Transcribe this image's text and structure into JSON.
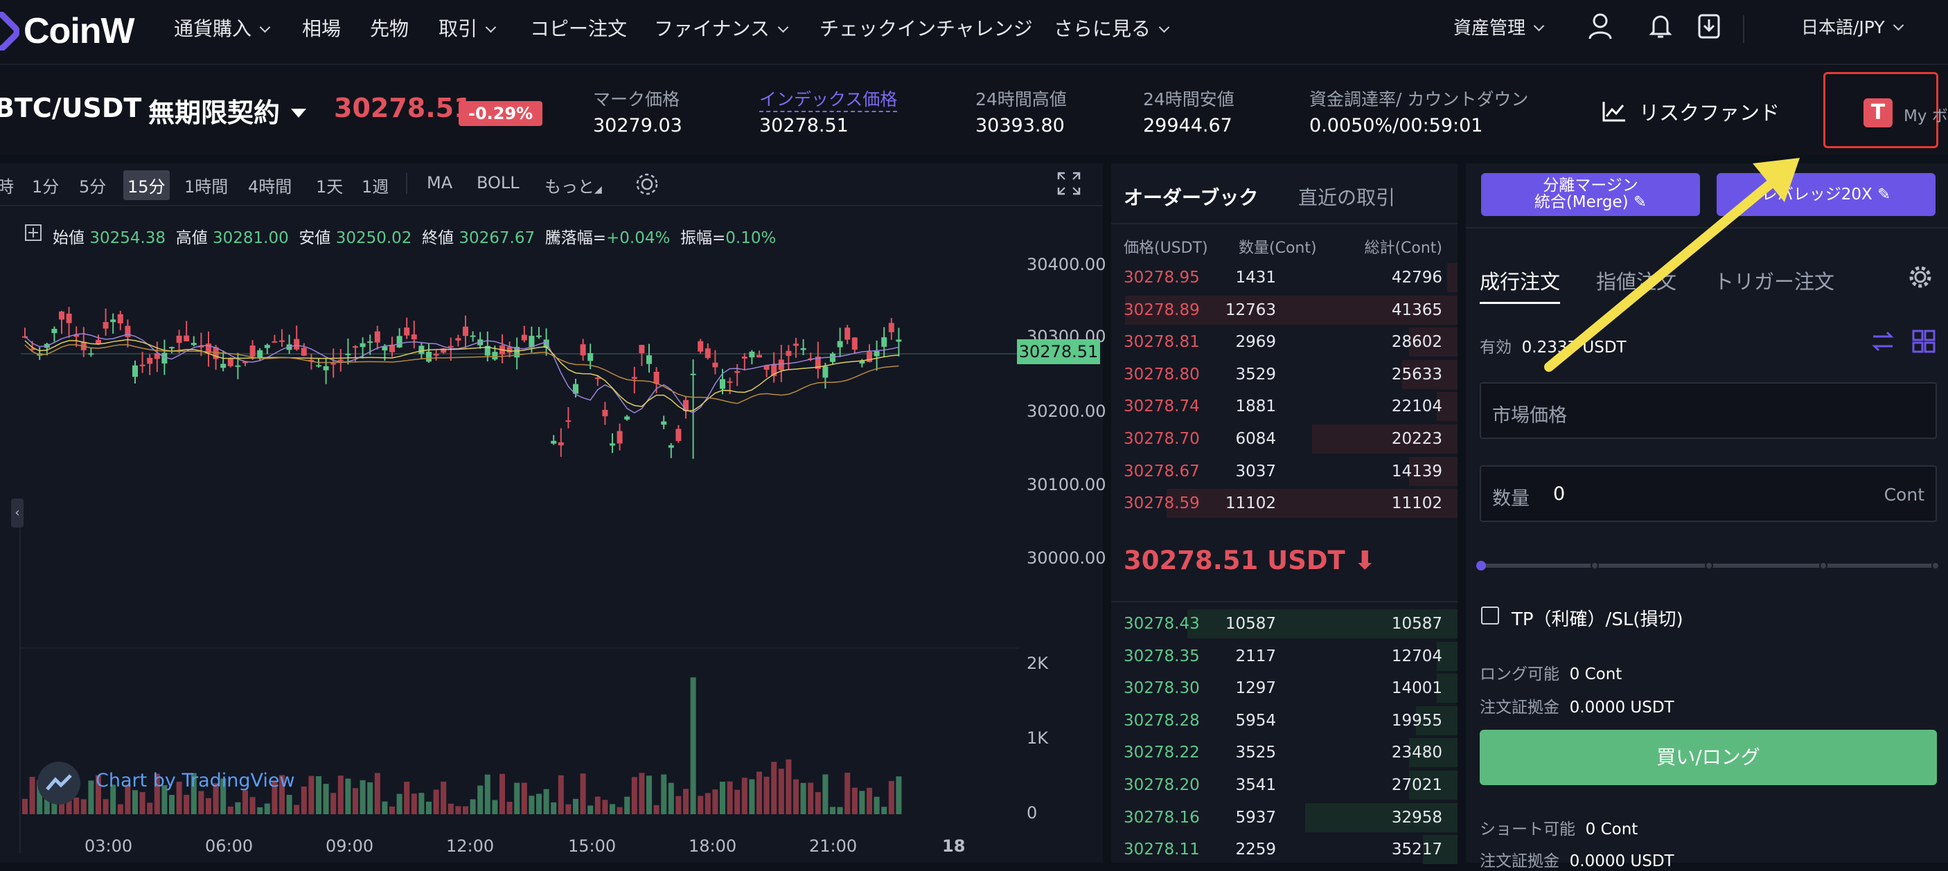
{
  "nav": {
    "logo": "CoinW",
    "items": [
      "通貨購入",
      "相場",
      "先物",
      "取引",
      "コピー注文",
      "ファイナンス",
      "チェックインチャレンジ",
      "さらに見る"
    ],
    "asset_mgmt": "資産管理",
    "language": "日本語/JPY"
  },
  "ticker": {
    "pair": "BTC/USDT",
    "contract": "無期限契約",
    "last_price": "30278.51",
    "change": "-0.29%",
    "mark_label": "マーク価格",
    "mark_value": "30279.03",
    "index_label": "インデックス価格",
    "index_value": "30278.51",
    "high_label": "24時間高値",
    "high_value": "30393.80",
    "low_label": "24時間安値",
    "low_value": "29944.67",
    "funding_label": "資金調達率/ カウントダウン",
    "funding_value": "0.0050%/00:59:01",
    "risk_fund": "リスクファンド",
    "my_label": "My ボ"
  },
  "chart": {
    "timeframes": [
      "時",
      "1分",
      "5分",
      "15分",
      "1時間",
      "4時間",
      "1天",
      "1週"
    ],
    "active_timeframe": "15分",
    "indicators": [
      "MA",
      "BOLL",
      "もっと"
    ],
    "ohlc": {
      "open_label": "始値",
      "open": "30254.38",
      "high_label": "高値",
      "high": "30281.00",
      "low_label": "安値",
      "low": "30250.02",
      "close_label": "終値",
      "close": "30267.67",
      "change_label": "騰落幅=",
      "change": "+0.04%",
      "amp_label": "振幅=",
      "amp": "0.10%"
    },
    "price_axis": [
      "30400.00",
      "30300.00",
      "30200.00",
      "30100.00",
      "30000.00"
    ],
    "current_price_tag": "30278.51",
    "volume_axis": [
      "2K",
      "1K",
      "0"
    ],
    "time_axis": [
      "03:00",
      "06:00",
      "09:00",
      "12:00",
      "15:00",
      "18:00",
      "21:00",
      "18"
    ],
    "watermark": "Chart by TradingView"
  },
  "orderbook": {
    "tab_active": "オーダーブック",
    "tab_recent": "直近の取引",
    "col_price": "価格(USDT)",
    "col_qty": "数量(Cont)",
    "col_total": "総計(Cont)",
    "asks": [
      {
        "price": "30278.95",
        "qty": "1431",
        "total": "42796",
        "depth": 0.03
      },
      {
        "price": "30278.89",
        "qty": "12763",
        "total": "41365",
        "depth": 0.96
      },
      {
        "price": "30278.81",
        "qty": "2969",
        "total": "28602",
        "depth": 0.14
      },
      {
        "price": "30278.80",
        "qty": "3529",
        "total": "25633",
        "depth": 0.16
      },
      {
        "price": "30278.74",
        "qty": "1881",
        "total": "22104",
        "depth": 0.06
      },
      {
        "price": "30278.70",
        "qty": "6084",
        "total": "20223",
        "depth": 0.42
      },
      {
        "price": "30278.67",
        "qty": "3037",
        "total": "14139",
        "depth": 0.14
      },
      {
        "price": "30278.59",
        "qty": "11102",
        "total": "11102",
        "depth": 0.84
      }
    ],
    "last_price": "30278.51 USDT",
    "bids": [
      {
        "price": "30278.43",
        "qty": "10587",
        "total": "10587",
        "depth": 0.78
      },
      {
        "price": "30278.35",
        "qty": "2117",
        "total": "12704",
        "depth": 0.06
      },
      {
        "price": "30278.30",
        "qty": "1297",
        "total": "14001",
        "depth": 0.06
      },
      {
        "price": "30278.28",
        "qty": "5954",
        "total": "19955",
        "depth": 0.12
      },
      {
        "price": "30278.22",
        "qty": "3525",
        "total": "23480",
        "depth": 0.14
      },
      {
        "price": "30278.20",
        "qty": "3541",
        "total": "27021",
        "depth": 0.14
      },
      {
        "price": "30278.16",
        "qty": "5937",
        "total": "32958",
        "depth": 0.44
      },
      {
        "price": "30278.11",
        "qty": "2259",
        "total": "35217",
        "depth": 0.1
      }
    ]
  },
  "trade": {
    "margin_btn_line1": "分離マージン",
    "margin_btn_line2": "統合(Merge)",
    "leverage_btn": "レバレッジ20X",
    "tabs": [
      "成行注文",
      "指値注文",
      "トリガー注文"
    ],
    "available_label": "有効",
    "available_value": "0.2337 USDT",
    "market_price_placeholder": "市場価格",
    "qty_label": "数量",
    "qty_value": "0",
    "qty_unit": "Cont",
    "tpsl_label": "TP（利確）/SL(損切)",
    "long_label": "ロング可能",
    "long_value": "0 Cont",
    "margin_label": "注文証拠金",
    "margin_value": "0.0000 USDT",
    "buy_btn": "買い/ロング",
    "short_label": "ショート可能",
    "short_value": "0 Cont",
    "margin2_label": "注文証拠金",
    "margin2_value": "0.0000 USDT"
  },
  "colors": {
    "accent": "#6b55e6",
    "up": "#5dc98a",
    "down": "#e2525e",
    "annotation_arrow": "#f4e04d",
    "highlight_box": "#e53935"
  }
}
